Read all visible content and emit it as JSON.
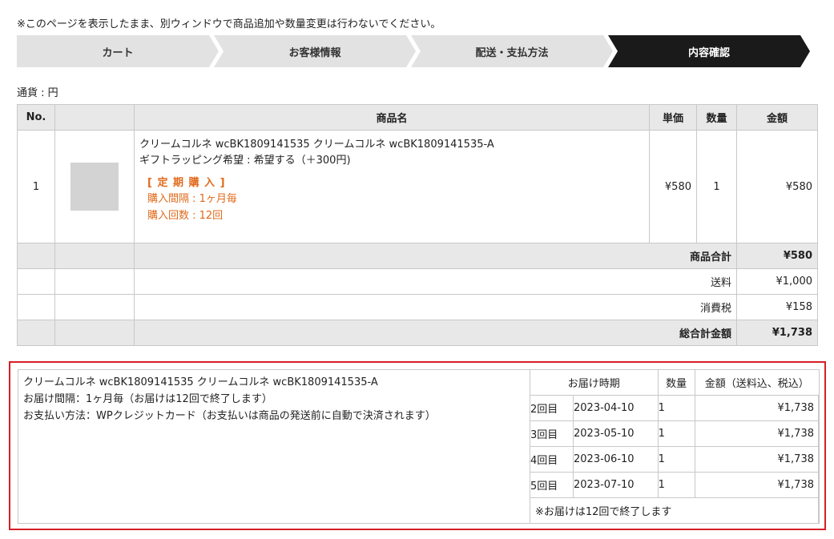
{
  "notice": "※このページを表示したまま、別ウィンドウで商品追加や数量変更は行わないでください。",
  "steps": [
    "カート",
    "お客様情報",
    "配送・支払方法",
    "内容確認"
  ],
  "currency": "通貨 : 円",
  "cart": {
    "headers": {
      "no": "No.",
      "name": "商品名",
      "price": "単価",
      "qty": "数量",
      "amount": "金額"
    },
    "item": {
      "no": "1",
      "name": "クリームコルネ wcBK1809141535 クリームコルネ wcBK1809141535-A",
      "option": "ギフトラッピング希望 : 希望する（＋300円)",
      "subscription_title": "[ 定 期 購 入 ]",
      "interval": "購入間隔 : 1ヶ月毎",
      "count": "購入回数 : 12回",
      "price": "¥580",
      "qty": "1",
      "amount": "¥580"
    },
    "subtotal_label": "商品合計",
    "subtotal": "¥580",
    "shipping_label": "送料",
    "shipping": "¥1,000",
    "tax_label": "消費税",
    "tax": "¥158",
    "total_label": "総合計金額",
    "total": "¥1,738"
  },
  "schedule": {
    "product": "クリームコルネ wcBK1809141535 クリームコルネ wcBK1809141535-A",
    "interval": "お届け間隔：1ヶ月毎（お届けは12回で終了します）",
    "payment": "お支払い方法：WPクレジットカード（お支払いは商品の発送前に自動で決済されます）",
    "headers": {
      "timing": "お届け時期",
      "qty": "数量",
      "amount": "金額（送料込、税込）"
    },
    "rows": [
      {
        "n": "2回目",
        "date": "2023-04-10",
        "qty": "1",
        "amount": "¥1,738"
      },
      {
        "n": "3回目",
        "date": "2023-05-10",
        "qty": "1",
        "amount": "¥1,738"
      },
      {
        "n": "4回目",
        "date": "2023-06-10",
        "qty": "1",
        "amount": "¥1,738"
      },
      {
        "n": "5回目",
        "date": "2023-07-10",
        "qty": "1",
        "amount": "¥1,738"
      }
    ],
    "footnote": "※お届けは12回で終了します"
  }
}
